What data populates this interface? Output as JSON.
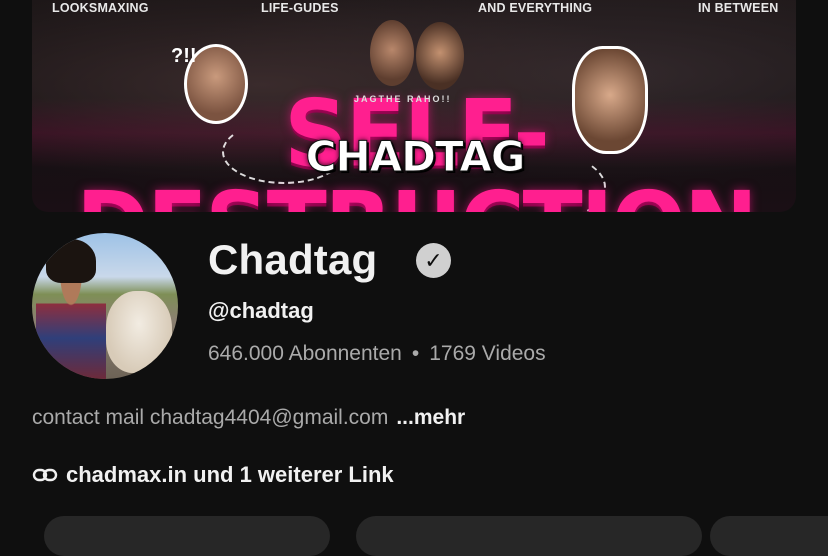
{
  "banner": {
    "taglines": [
      "LOOKSMAXING",
      "LIFE-GUDES",
      "AND EVERYTHING",
      "IN BETWEEN"
    ],
    "headline": "SELF-DESTRUCTION",
    "overlay_text": "CHADTAG",
    "exclaim": "?!!",
    "small_text": "JAGTHE RAHO!!",
    "accent_color": "#ff1f8f"
  },
  "channel": {
    "name": "Chadtag",
    "verified_icon": "checkmark-icon",
    "handle": "@chadtag",
    "subscribers": "646.000 Abonnenten",
    "separator": "•",
    "videos": "1769 Videos",
    "description": "contact mail chadtag4404@gmail.com",
    "more_label": "...mehr",
    "links_text": "chadmax.in und 1 weiterer Link",
    "link_icon": "link-icon"
  },
  "colors": {
    "background": "#0f0f0f",
    "primary_text": "#f1f1f1",
    "secondary_text": "#aaaaaa"
  }
}
